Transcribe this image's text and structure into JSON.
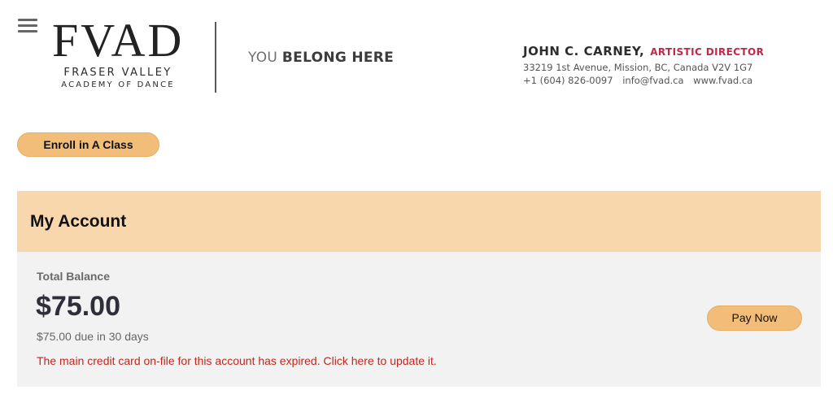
{
  "header": {
    "menu_icon": "hamburger-menu-icon",
    "logo": {
      "mark": "FVAD",
      "line1": "FRASER VALLEY",
      "line2": "ACADEMY OF DANCE"
    },
    "tagline_prefix": "YOU",
    "tagline_strong": "BELONG HERE",
    "director_name": "JOHN C. CARNEY,",
    "director_title": "ARTISTIC DIRECTOR",
    "address": "33219 1st Avenue, Mission, BC, Canada V2V 1G7",
    "phone": "+1 (604) 826-0097",
    "email": "info@fvad.ca",
    "website": "www.fvad.ca"
  },
  "actions": {
    "enroll_label": "Enroll in A Class"
  },
  "account": {
    "title": "My Account",
    "balance_label": "Total Balance",
    "balance_amount": "$75.00",
    "balance_due": "$75.00 due in 30 days",
    "card_warning": "The main credit card on-file for this account has expired. Click here to update it.",
    "pay_label": "Pay Now"
  },
  "colors": {
    "accent_button": "#f2bd78",
    "account_header_bg": "#f8d7ad",
    "account_body_bg": "#f2f2f2",
    "warning_text": "#c0281e",
    "director_title": "#c0284a"
  }
}
